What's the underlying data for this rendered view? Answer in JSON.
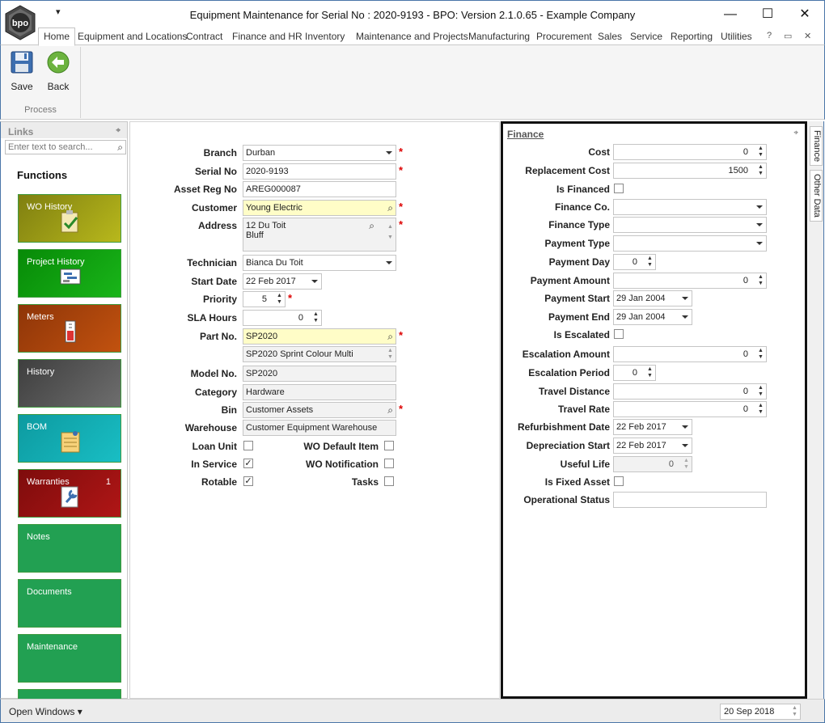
{
  "window": {
    "title": "Equipment Maintenance for Serial No : 2020-9193 - BPO: Version 2.1.0.65 - Example Company",
    "quick_access": "▾",
    "minimize": "—",
    "maximize": "☐",
    "close": "✕",
    "logo_text": "bpo"
  },
  "menu": {
    "tabs": [
      "Home",
      "Equipment and Locations",
      "Contract",
      "Finance and HR",
      "Inventory",
      "Maintenance and Projects",
      "Manufacturing",
      "Procurement",
      "Sales",
      "Service",
      "Reporting",
      "Utilities"
    ],
    "help_icon": "?",
    "restore_icon": "▭"
  },
  "ribbon": {
    "save_label": "Save",
    "back_label": "Back",
    "group_label": "Process"
  },
  "links": {
    "title": "Links",
    "search_placeholder": "Enter text to search...",
    "functions_label": "Functions",
    "tiles": [
      {
        "label": "WO History",
        "color": "#9a9a16"
      },
      {
        "label": "Project History",
        "color": "#0f9a0f"
      },
      {
        "label": "Meters",
        "color": "#a8420a"
      },
      {
        "label": "History",
        "color": "#555555"
      },
      {
        "label": "BOM",
        "color": "#12a8b0"
      },
      {
        "label": "Warranties",
        "color": "#9a0f0f",
        "badge": "1"
      },
      {
        "label": "Notes",
        "color": "#22a052"
      },
      {
        "label": "Documents",
        "color": "#22a052"
      },
      {
        "label": "Maintenance",
        "color": "#22a052"
      }
    ]
  },
  "form": {
    "branch": {
      "label": "Branch",
      "value": "Durban"
    },
    "serial_no": {
      "label": "Serial No",
      "value": "2020-9193"
    },
    "asset_reg_no": {
      "label": "Asset Reg No",
      "value": "AREG000087"
    },
    "customer": {
      "label": "Customer",
      "value": "Young Electric"
    },
    "address": {
      "label": "Address",
      "line1": "12 Du Toit",
      "line2": "Bluff"
    },
    "technician": {
      "label": "Technician",
      "value": "Bianca Du Toit"
    },
    "start_date": {
      "label": "Start Date",
      "value": "22 Feb 2017"
    },
    "priority": {
      "label": "Priority",
      "value": "5"
    },
    "sla_hours": {
      "label": "SLA Hours",
      "value": "0"
    },
    "part_no": {
      "label": "Part No.",
      "value": "SP2020",
      "description": "SP2020 Sprint Colour Multi"
    },
    "model_no": {
      "label": "Model No.",
      "value": "SP2020"
    },
    "category": {
      "label": "Category",
      "value": "Hardware"
    },
    "bin": {
      "label": "Bin",
      "value": "Customer Assets"
    },
    "warehouse": {
      "label": "Warehouse",
      "value": "Customer Equipment Warehouse"
    },
    "loan_unit": {
      "label": "Loan Unit",
      "checked": false
    },
    "in_service": {
      "label": "In Service",
      "checked": true
    },
    "rotable": {
      "label": "Rotable",
      "checked": true
    },
    "wo_default_item": {
      "label": "WO Default Item",
      "checked": false
    },
    "wo_notification": {
      "label": "WO Notification",
      "checked": false
    },
    "tasks": {
      "label": "Tasks",
      "checked": false
    },
    "required_mark": "*"
  },
  "finance": {
    "title": "Finance",
    "cost": {
      "label": "Cost",
      "value": "0"
    },
    "replacement_cost": {
      "label": "Replacement Cost",
      "value": "1500"
    },
    "is_financed": {
      "label": "Is Financed",
      "checked": false
    },
    "finance_co": {
      "label": "Finance Co.",
      "value": ""
    },
    "finance_type": {
      "label": "Finance Type",
      "value": ""
    },
    "payment_type": {
      "label": "Payment Type",
      "value": ""
    },
    "payment_day": {
      "label": "Payment Day",
      "value": "0"
    },
    "payment_amount": {
      "label": "Payment Amount",
      "value": "0"
    },
    "payment_start": {
      "label": "Payment Start",
      "value": "29 Jan 2004"
    },
    "payment_end": {
      "label": "Payment End",
      "value": "29 Jan 2004"
    },
    "is_escalated": {
      "label": "Is Escalated",
      "checked": false
    },
    "escalation_amount": {
      "label": "Escalation Amount",
      "value": "0"
    },
    "escalation_period": {
      "label": "Escalation Period",
      "value": "0"
    },
    "travel_distance": {
      "label": "Travel Distance",
      "value": "0"
    },
    "travel_rate": {
      "label": "Travel Rate",
      "value": "0"
    },
    "refurbishment_date": {
      "label": "Refurbishment Date",
      "value": "22 Feb 2017"
    },
    "depreciation_start": {
      "label": "Depreciation Start",
      "value": "22 Feb 2017"
    },
    "useful_life": {
      "label": "Useful Life",
      "value": "0"
    },
    "is_fixed_asset": {
      "label": "Is Fixed Asset",
      "checked": false
    },
    "operational_status": {
      "label": "Operational Status",
      "value": ""
    }
  },
  "side_tabs": [
    "Finance",
    "Other Data"
  ],
  "status": {
    "open_windows": "Open Windows ▾",
    "date": "20 Sep 2018"
  },
  "icons": {
    "search": "⌕",
    "pin": "⌖",
    "check": "✓"
  }
}
